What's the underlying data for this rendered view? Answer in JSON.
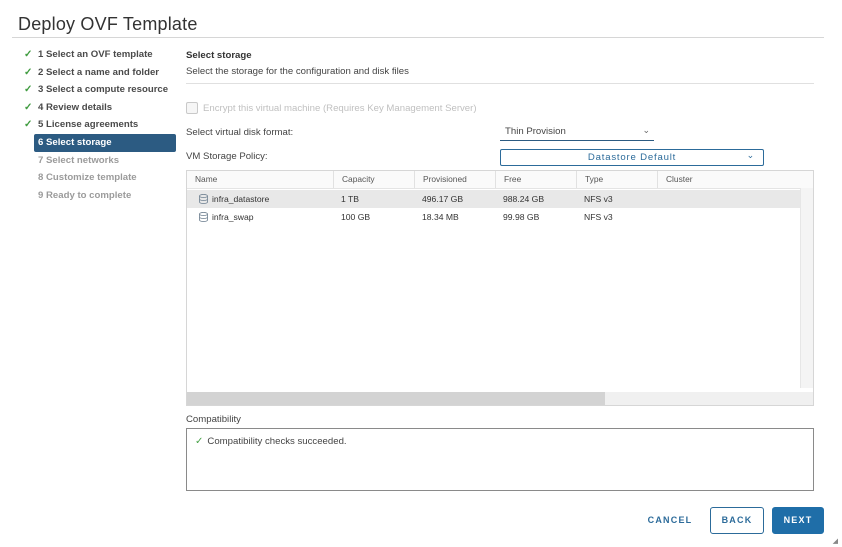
{
  "window": {
    "title": "Deploy OVF Template"
  },
  "steps": [
    {
      "label": "1 Select an OVF template",
      "state": "done"
    },
    {
      "label": "2 Select a name and folder",
      "state": "done"
    },
    {
      "label": "3 Select a compute resource",
      "state": "done"
    },
    {
      "label": "4 Review details",
      "state": "done"
    },
    {
      "label": "5 License agreements",
      "state": "done"
    },
    {
      "label": "6 Select storage",
      "state": "current"
    },
    {
      "label": "7 Select networks",
      "state": "future"
    },
    {
      "label": "8 Customize template",
      "state": "future"
    },
    {
      "label": "9 Ready to complete",
      "state": "future"
    }
  ],
  "main": {
    "title": "Select storage",
    "description": "Select the storage for the configuration and disk files",
    "encrypt": {
      "label": "Encrypt this virtual machine (Requires Key Management Server)",
      "checked": false,
      "disabled": true
    },
    "disk_format": {
      "label": "Select virtual disk format:",
      "value": "Thin Provision"
    },
    "storage_policy": {
      "label": "VM Storage Policy:",
      "value": "Datastore Default"
    }
  },
  "table": {
    "columns": [
      "Name",
      "Capacity",
      "Provisioned",
      "Free",
      "Type",
      "Cluster"
    ],
    "rows": [
      {
        "name": "infra_datastore",
        "capacity": "1 TB",
        "provisioned": "496.17 GB",
        "free": "988.24 GB",
        "type": "NFS v3",
        "cluster": "",
        "selected": true
      },
      {
        "name": "infra_swap",
        "capacity": "100 GB",
        "provisioned": "18.34 MB",
        "free": "99.98 GB",
        "type": "NFS v3",
        "cluster": "",
        "selected": false
      }
    ]
  },
  "compatibility": {
    "label": "Compatibility",
    "message": "Compatibility checks succeeded."
  },
  "buttons": {
    "cancel": "CANCEL",
    "back": "BACK",
    "next": "NEXT"
  },
  "icons": {
    "step_done": "check-icon",
    "datastore": "datastore-icon",
    "dropdown": "chevron-down-icon",
    "compat_ok": "check-icon"
  },
  "colors": {
    "accent": "#2c5b82",
    "primary_button": "#1f6ea8",
    "success": "#3f9b3f"
  }
}
